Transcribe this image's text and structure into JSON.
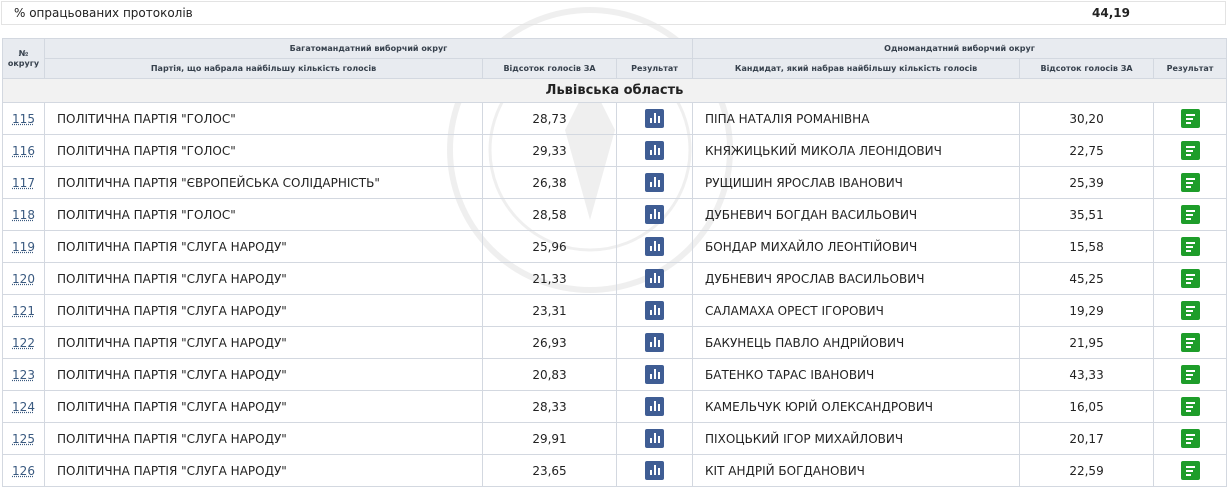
{
  "summary": {
    "label": "% опрацьованих протоколів",
    "value": "44,19"
  },
  "table": {
    "headers": {
      "district_no": "№ округу",
      "multi_group": "Багатомандатний виборчий округ",
      "single_group": "Одномандатний виборчий округ",
      "party": "Партія, що набрала найбільшу кількість голосів",
      "party_pct": "Відсоток голосів ЗА",
      "party_result": "Результат",
      "candidate": "Кандидат, який набрав найбільшу кількість голосів",
      "cand_pct": "Відсоток голосів ЗА",
      "cand_result": "Результат"
    },
    "region": "Львівська область",
    "icons": {
      "party_result": "bar-chart-icon",
      "candidate_result": "document-icon",
      "party_result_color": "#3f5d94",
      "candidate_result_color": "#1e9d2a"
    },
    "rows": [
      {
        "no": "115",
        "party": "ПОЛІТИЧНА ПАРТІЯ \"ГОЛОС\"",
        "party_pct": "28,73",
        "candidate": "ПІПА НАТАЛІЯ РОМАНІВНА",
        "cand_pct": "30,20"
      },
      {
        "no": "116",
        "party": "ПОЛІТИЧНА ПАРТІЯ \"ГОЛОС\"",
        "party_pct": "29,33",
        "candidate": "КНЯЖИЦЬКИЙ МИКОЛА ЛЕОНІДОВИЧ",
        "cand_pct": "22,75"
      },
      {
        "no": "117",
        "party": "ПОЛІТИЧНА ПАРТІЯ \"ЄВРОПЕЙСЬКА СОЛІДАРНІСТЬ\"",
        "party_pct": "26,38",
        "candidate": "РУЩИШИН ЯРОСЛАВ ІВАНОВИЧ",
        "cand_pct": "25,39"
      },
      {
        "no": "118",
        "party": "ПОЛІТИЧНА ПАРТІЯ \"ГОЛОС\"",
        "party_pct": "28,58",
        "candidate": "ДУБНЕВИЧ БОГДАН ВАСИЛЬОВИЧ",
        "cand_pct": "35,51"
      },
      {
        "no": "119",
        "party": "ПОЛІТИЧНА ПАРТІЯ \"СЛУГА НАРОДУ\"",
        "party_pct": "25,96",
        "candidate": "БОНДАР МИХАЙЛО ЛЕОНТІЙОВИЧ",
        "cand_pct": "15,58"
      },
      {
        "no": "120",
        "party": "ПОЛІТИЧНА ПАРТІЯ \"СЛУГА НАРОДУ\"",
        "party_pct": "21,33",
        "candidate": "ДУБНЕВИЧ ЯРОСЛАВ ВАСИЛЬОВИЧ",
        "cand_pct": "45,25"
      },
      {
        "no": "121",
        "party": "ПОЛІТИЧНА ПАРТІЯ \"СЛУГА НАРОДУ\"",
        "party_pct": "23,31",
        "candidate": "САЛАМАХА ОРЕСТ ІГОРОВИЧ",
        "cand_pct": "19,29"
      },
      {
        "no": "122",
        "party": "ПОЛІТИЧНА ПАРТІЯ \"СЛУГА НАРОДУ\"",
        "party_pct": "26,93",
        "candidate": "БАКУНЕЦЬ ПАВЛО АНДРІЙОВИЧ",
        "cand_pct": "21,95"
      },
      {
        "no": "123",
        "party": "ПОЛІТИЧНА ПАРТІЯ \"СЛУГА НАРОДУ\"",
        "party_pct": "20,83",
        "candidate": "БАТЕНКО ТАРАС ІВАНОВИЧ",
        "cand_pct": "43,33"
      },
      {
        "no": "124",
        "party": "ПОЛІТИЧНА ПАРТІЯ \"СЛУГА НАРОДУ\"",
        "party_pct": "28,33",
        "candidate": "КАМЕЛЬЧУК ЮРІЙ ОЛЕКСАНДРОВИЧ",
        "cand_pct": "16,05"
      },
      {
        "no": "125",
        "party": "ПОЛІТИЧНА ПАРТІЯ \"СЛУГА НАРОДУ\"",
        "party_pct": "29,91",
        "candidate": "ПІХОЦЬКИЙ ІГОР МИХАЙЛОВИЧ",
        "cand_pct": "20,17"
      },
      {
        "no": "126",
        "party": "ПОЛІТИЧНА ПАРТІЯ \"СЛУГА НАРОДУ\"",
        "party_pct": "23,65",
        "candidate": "КІТ АНДРІЙ БОГДАНОВИЧ",
        "cand_pct": "22,59"
      }
    ]
  }
}
